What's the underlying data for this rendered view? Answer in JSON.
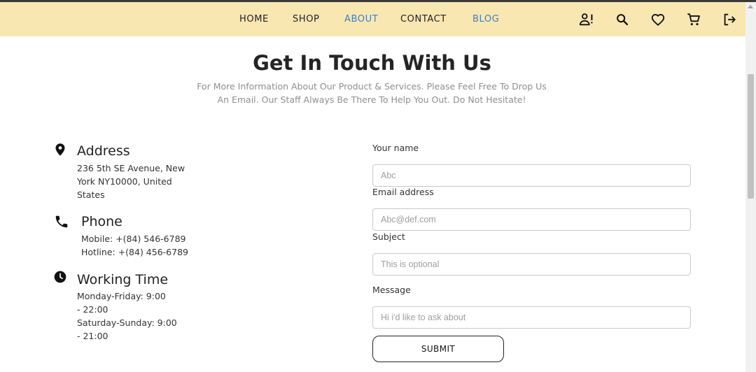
{
  "nav": {
    "links": [
      {
        "label": "HOME"
      },
      {
        "label": "SHOP"
      },
      {
        "label": "ABOUT"
      },
      {
        "label": "CONTACT"
      },
      {
        "label": "BLOG"
      }
    ],
    "active_color": "#3f7fc0",
    "background": "#f9e7b2",
    "icons": [
      "user-alert-icon",
      "search-icon",
      "heart-icon",
      "cart-icon",
      "logout-icon"
    ]
  },
  "header": {
    "title": "Get In Touch With Us",
    "subtitle_line1": "For More Information About Our Product & Services. Please Feel Free To Drop Us",
    "subtitle_line2": "An Email. Our Staff Always Be There To Help You Out. Do Not Hesitate!"
  },
  "contact_info": {
    "address": {
      "icon": "location-pin-icon",
      "heading": "Address",
      "lines": [
        "236 5th SE Avenue, New",
        "York NY10000, United",
        "States"
      ]
    },
    "phone": {
      "icon": "phone-icon",
      "heading": "Phone",
      "lines": [
        "Mobile: +(84) 546-6789",
        "Hotline: +(84) 456-6789"
      ]
    },
    "working_time": {
      "icon": "clock-icon",
      "heading": "Working Time",
      "lines": [
        "Monday-Friday: 9:00",
        "- 22:00",
        "Saturday-Sunday: 9:00",
        "- 21:00"
      ]
    }
  },
  "form": {
    "name": {
      "label": "Your name",
      "placeholder": "Abc",
      "value": ""
    },
    "email": {
      "label": "Email address",
      "placeholder": "Abc@def.com",
      "value": ""
    },
    "subject": {
      "label": "Subject",
      "placeholder": "This is optional",
      "value": ""
    },
    "message": {
      "label": "Message",
      "placeholder": "Hi i'd like to ask about",
      "value": ""
    },
    "submit_label": "SUBMIT"
  }
}
